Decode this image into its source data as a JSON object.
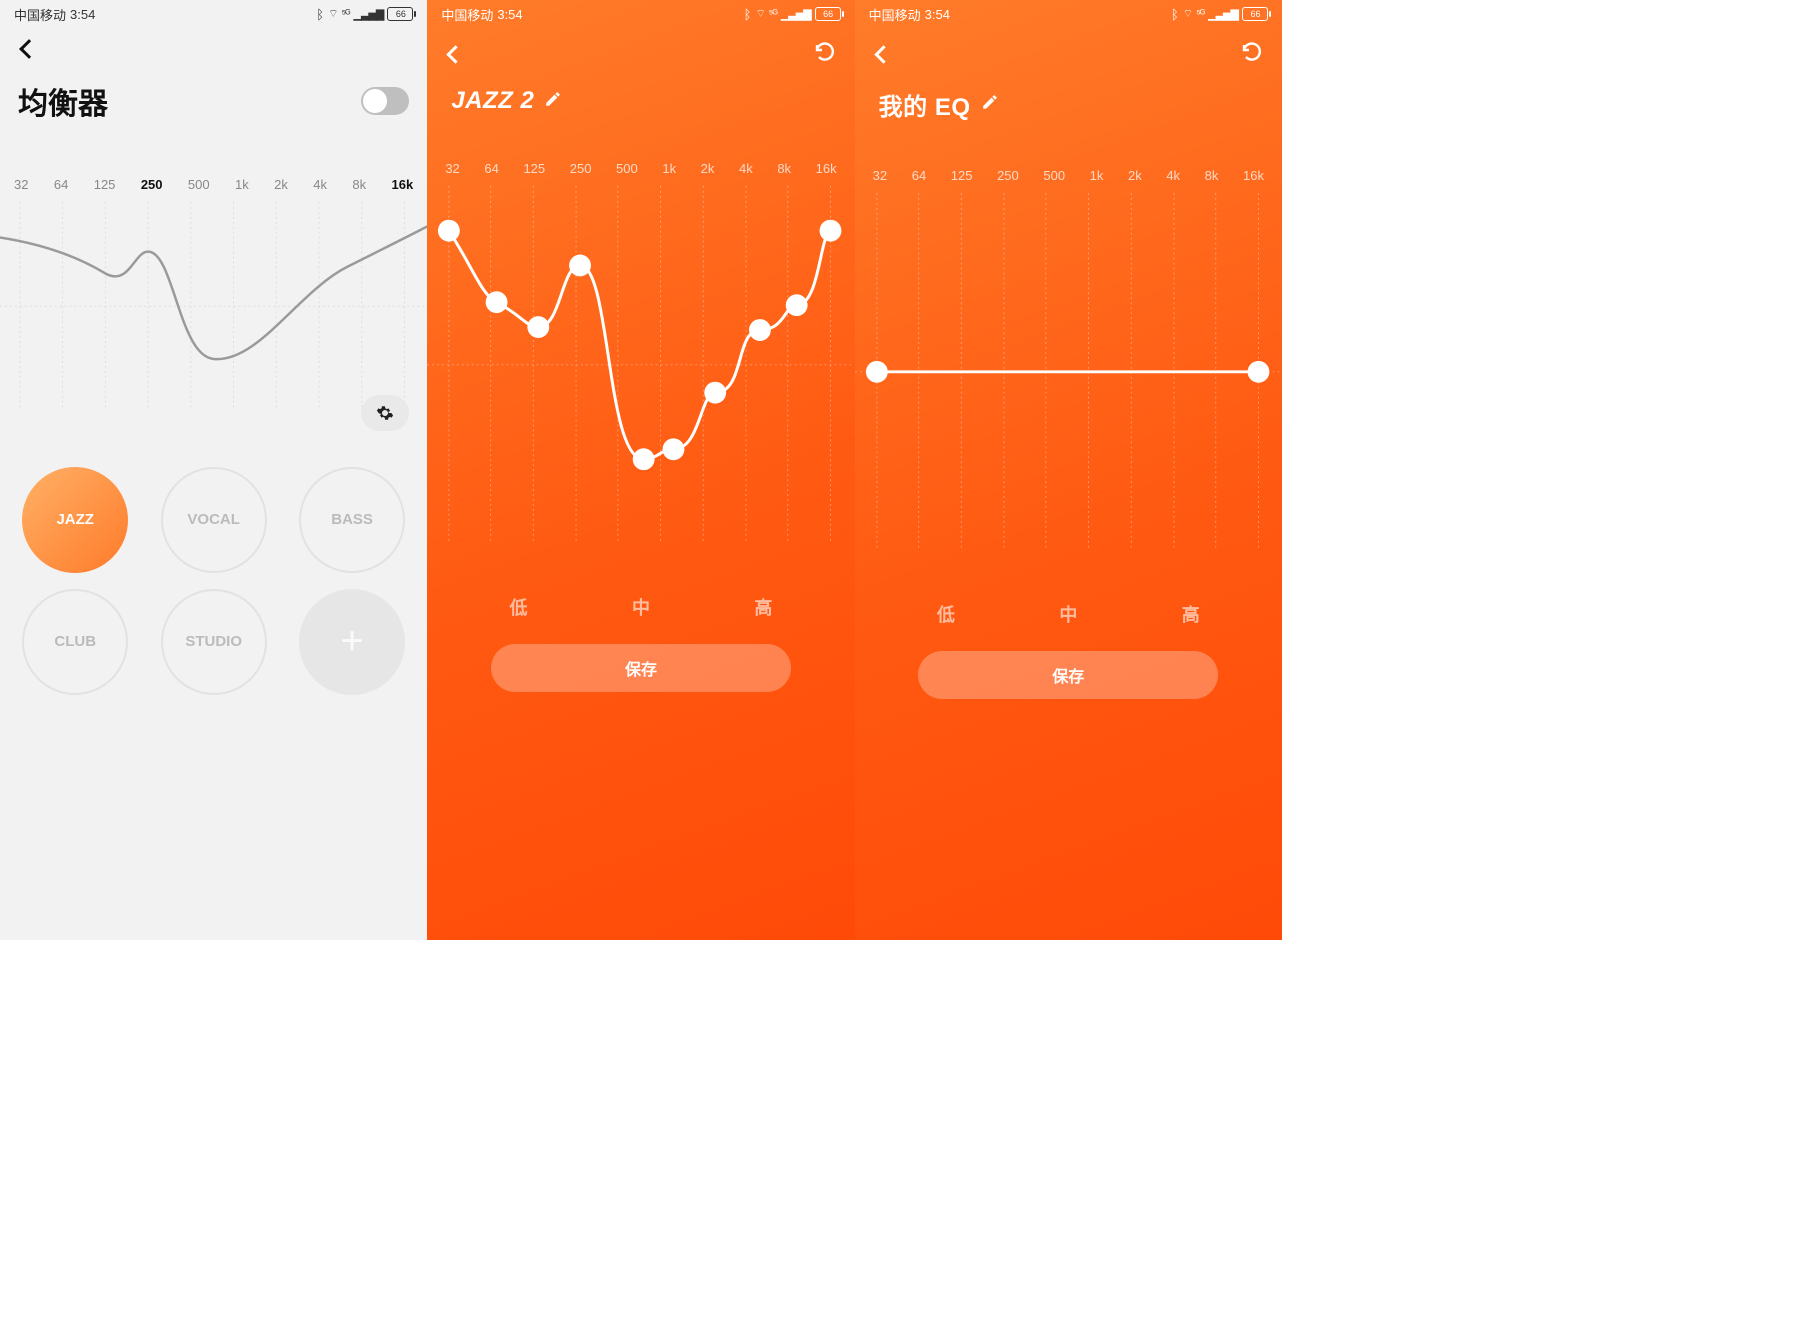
{
  "status": {
    "carrier": "中国移动",
    "time": "3:54",
    "signal": "⁵ᴳ",
    "battery": "66"
  },
  "screen1": {
    "title": "均衡器",
    "freq_labels": [
      "32",
      "64",
      "125",
      "250",
      "500",
      "1k",
      "2k",
      "4k",
      "8k",
      "16k"
    ],
    "strong_idx": [
      3,
      9
    ],
    "presets": [
      "JAZZ",
      "VOCAL",
      "BASS",
      "CLUB",
      "STUDIO"
    ],
    "add_symbol": "+"
  },
  "screen2": {
    "title": "JAZZ 2",
    "freq_labels": [
      "32",
      "64",
      "125",
      "250",
      "500",
      "1k",
      "2k",
      "4k",
      "8k",
      "16k"
    ],
    "tabs": [
      "低",
      "中",
      "高"
    ],
    "save_label": "保存"
  },
  "screen3": {
    "title": "我的 EQ",
    "freq_labels": [
      "32",
      "64",
      "125",
      "250",
      "500",
      "1k",
      "2k",
      "4k",
      "8k",
      "16k"
    ],
    "tabs": [
      "低",
      "中",
      "高"
    ],
    "save_label": "保存"
  },
  "chart_data": [
    {
      "type": "line",
      "screen": 1,
      "title": "EQ preview (JAZZ)",
      "x_labels": [
        "32",
        "64",
        "125",
        "250",
        "500",
        "1k",
        "2k",
        "4k",
        "8k",
        "16k"
      ],
      "ylim": [
        -6,
        6
      ],
      "values": [
        4.5,
        3.5,
        2.0,
        3.5,
        -4.5,
        -4.0,
        -1.0,
        1.0,
        2.5,
        4.5
      ]
    },
    {
      "type": "line",
      "screen": 2,
      "title": "JAZZ 2 EQ curve",
      "x_labels": [
        "32",
        "64",
        "125",
        "250",
        "500",
        "1k",
        "2k",
        "4k",
        "8k",
        "16k"
      ],
      "ylim": [
        -6,
        6
      ],
      "values": [
        4.5,
        2.0,
        1.2,
        3.0,
        -3.8,
        -3.5,
        -1.0,
        1.2,
        2.0,
        4.5
      ]
    },
    {
      "type": "line",
      "screen": 3,
      "title": "我的 EQ curve (flat)",
      "x_labels": [
        "32",
        "64",
        "125",
        "250",
        "500",
        "1k",
        "2k",
        "4k",
        "8k",
        "16k"
      ],
      "ylim": [
        -6,
        6
      ],
      "values": [
        0,
        0,
        0,
        0,
        0,
        0,
        0,
        0,
        0,
        0
      ]
    }
  ]
}
